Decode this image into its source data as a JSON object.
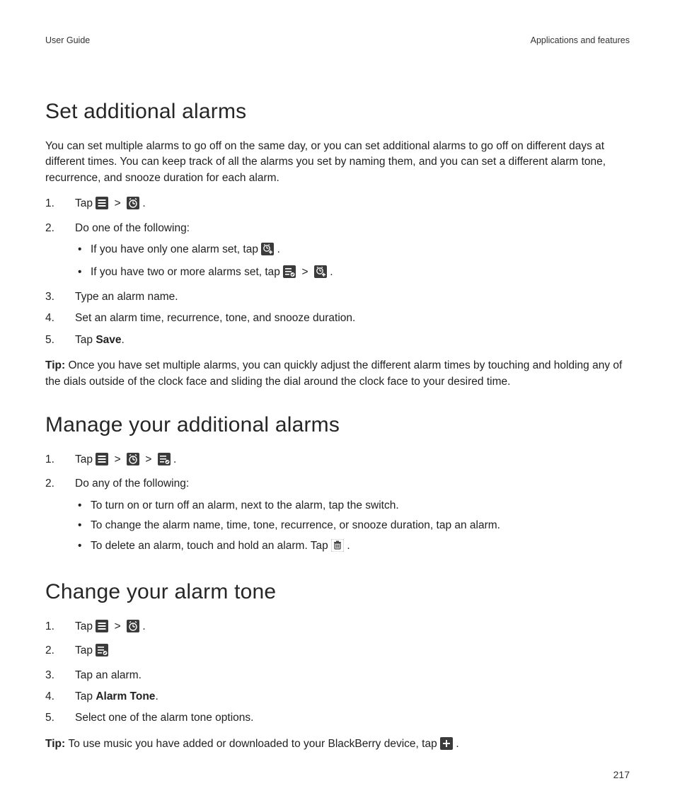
{
  "header": {
    "left": "User Guide",
    "right": "Applications and features"
  },
  "pageNumber": "217",
  "separator": ">",
  "period": ".",
  "section1": {
    "title": "Set additional alarms",
    "intro": "You can set multiple alarms to go off on the same day, or you can set additional alarms to go off on different days at different times. You can keep track of all the alarms you set by naming them, and you can set a different alarm tone, recurrence, and snooze duration for each alarm.",
    "step1_tap": "Tap ",
    "step2": "Do one of the following:",
    "bullet_a_pre": "If you have only one alarm set, tap ",
    "bullet_b_pre": "If you have two or more alarms set, tap ",
    "step3": "Type an alarm name.",
    "step4": "Set an alarm time, recurrence, tone, and snooze duration.",
    "step5_tap": "Tap ",
    "step5_bold": "Save",
    "tip_label": "Tip: ",
    "tip_text": "Once you have set multiple alarms, you can quickly adjust the different alarm times by touching and holding any of the dials outside of the clock face and sliding the dial around the clock face to your desired time."
  },
  "section2": {
    "title": "Manage your additional alarms",
    "step1_tap": "Tap ",
    "step2": "Do any of the following:",
    "bullet_a": "To turn on or turn off an alarm, next to the alarm, tap the switch.",
    "bullet_b": "To change the alarm name, time, tone, recurrence, or snooze duration, tap an alarm.",
    "bullet_c_pre": "To delete an alarm, touch and hold an alarm. Tap "
  },
  "section3": {
    "title": "Change your alarm tone",
    "step1_tap": "Tap ",
    "step2_tap": "Tap ",
    "step3": "Tap an alarm.",
    "step4_tap": "Tap ",
    "step4_bold": "Alarm Tone",
    "step5": "Select one of the alarm tone options.",
    "tip_label": "Tip: ",
    "tip_text": "To use music you have added or downloaded to your BlackBerry device, tap "
  }
}
